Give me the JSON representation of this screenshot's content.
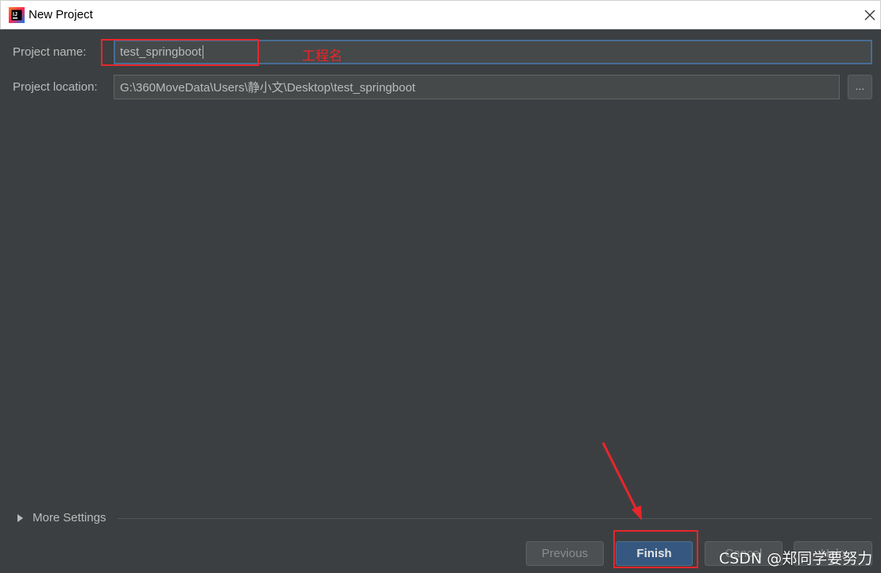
{
  "window": {
    "title": "New Project",
    "icon": "intellij-idea-icon"
  },
  "form": {
    "name_label": "Project name:",
    "name_value": "test_springboot",
    "location_label": "Project location:",
    "location_value": "G:\\360MoveData\\Users\\静小文\\Desktop\\test_springboot",
    "browse_label": "..."
  },
  "annotations": {
    "name_note": "工程名",
    "highlight_color": "#e8262b"
  },
  "more_settings": {
    "label": "More Settings"
  },
  "buttons": {
    "previous": "Previous",
    "finish": "Finish",
    "cancel": "Cancel",
    "help": "Help"
  },
  "watermark": "CSDN @郑同学要努力",
  "colors": {
    "background": "#3c3f41",
    "primary_button": "#365880",
    "focus_border": "#466d94"
  }
}
